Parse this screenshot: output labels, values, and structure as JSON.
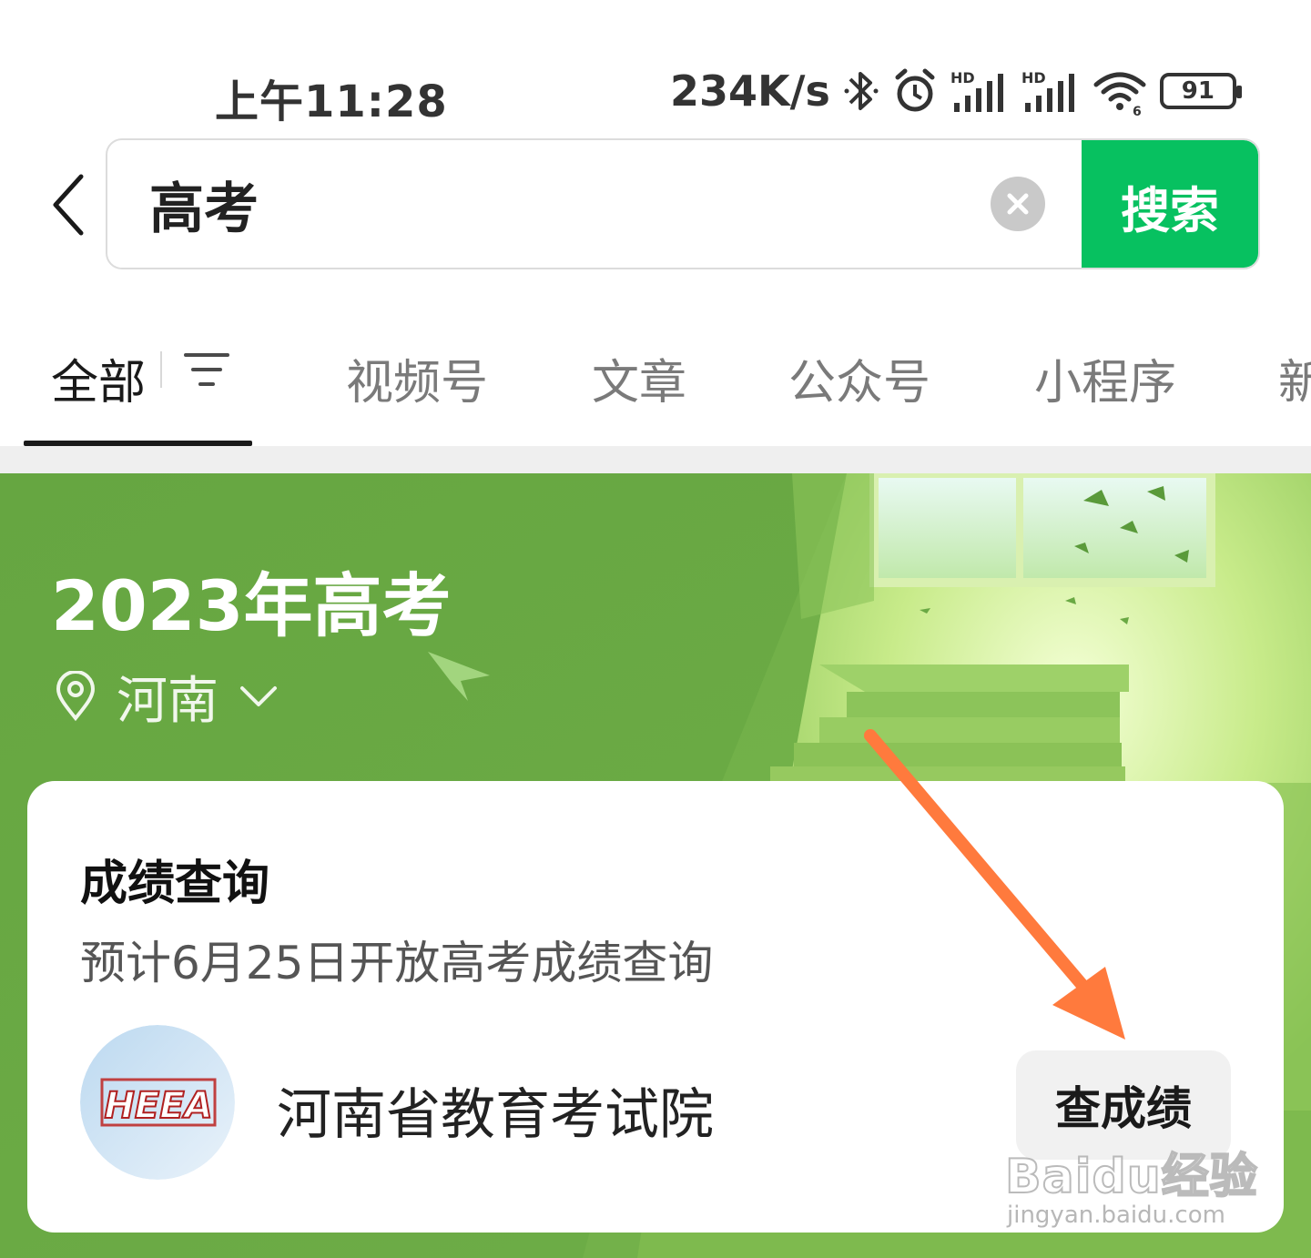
{
  "status_bar": {
    "time": "上午11:28",
    "network_speed": "234K/s",
    "battery_level": "91",
    "icons": [
      "bluetooth-icon",
      "alarm-icon",
      "hd-signal-icon",
      "hd-signal-icon",
      "wifi-icon",
      "battery-icon"
    ]
  },
  "search": {
    "query": "高考",
    "button_label": "搜索"
  },
  "tabs": [
    {
      "label": "全部",
      "active": true
    },
    {
      "label": "视频号",
      "active": false
    },
    {
      "label": "文章",
      "active": false
    },
    {
      "label": "公众号",
      "active": false
    },
    {
      "label": "小程序",
      "active": false
    },
    {
      "label": "新",
      "active": false
    }
  ],
  "banner": {
    "title": "2023年高考",
    "location": "河南"
  },
  "card": {
    "title": "成绩查询",
    "subtitle": "预计6月25日开放高考成绩查询",
    "org_logo_text": "HEEA",
    "org_name": "河南省教育考试院",
    "action_label": "查成绩"
  },
  "watermark": {
    "main": "Baidu经验",
    "sub": "jingyan.baidu.com"
  },
  "colors": {
    "search_button": "#07c160",
    "banner_green": "#6aa944",
    "annotation_arrow": "#ff7a3d"
  }
}
